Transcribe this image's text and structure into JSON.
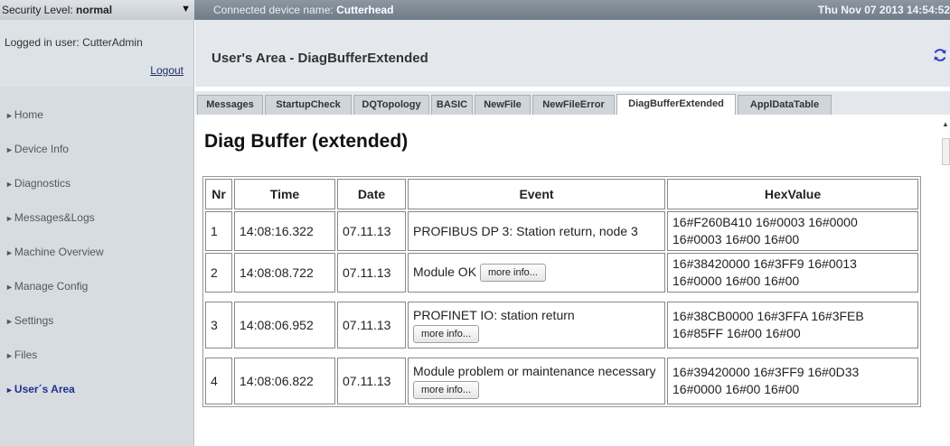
{
  "topbar": {
    "security_label": "Security Level:",
    "security_value": "normal",
    "connected_label": "Connected device name:",
    "device_name": "Cutterhead",
    "datetime": "Thu Nov 07 2013 14:54:52"
  },
  "login": {
    "user_text": "Logged in user: CutterAdmin",
    "logout": "Logout"
  },
  "sidebar": {
    "items": [
      {
        "label": "Home"
      },
      {
        "label": "Device Info"
      },
      {
        "label": "Diagnostics"
      },
      {
        "label": "Messages&Logs"
      },
      {
        "label": "Machine Overview"
      },
      {
        "label": "Manage Config"
      },
      {
        "label": "Settings"
      },
      {
        "label": "Files"
      },
      {
        "label": "User´s Area"
      }
    ],
    "active_index": 8
  },
  "header": {
    "title": "User's Area - DiagBufferExtended",
    "refresh_icon": "refresh-icon"
  },
  "tabs": [
    {
      "label": "Messages"
    },
    {
      "label": "StartupCheck"
    },
    {
      "label": "DQTopology"
    },
    {
      "label": "BASIC"
    },
    {
      "label": "NewFile"
    },
    {
      "label": "NewFileError"
    },
    {
      "label": "DiagBufferExtended"
    },
    {
      "label": "ApplDataTable"
    }
  ],
  "active_tab": 6,
  "page": {
    "heading": "Diag Buffer (extended)"
  },
  "table": {
    "headers": [
      "Nr",
      "Time",
      "Date",
      "Event",
      "HexValue"
    ],
    "rows": [
      {
        "nr": "1",
        "time": "14:08:16.322",
        "date": "07.11.13",
        "event": "PROFIBUS DP 3: Station return, node 3",
        "hex1": "16#F260B410 16#0003 16#0000",
        "hex2": "16#0003 16#00 16#00",
        "button": ""
      },
      {
        "nr": "2",
        "time": "14:08:08.722",
        "date": "07.11.13",
        "event": "Module OK",
        "hex1": "16#38420000 16#3FF9 16#0013",
        "hex2": "16#0000 16#00 16#00",
        "button": "more info..."
      },
      {
        "nr": "3",
        "time": "14:08:06.952",
        "date": "07.11.13",
        "event": "PROFINET IO: station return",
        "hex1": "16#38CB0000 16#3FFA 16#3FEB",
        "hex2": "16#85FF 16#00 16#00",
        "button": "more info..."
      },
      {
        "nr": "4",
        "time": "14:08:06.822",
        "date": "07.11.13",
        "event": "Module problem or maintenance necessary",
        "hex1": "16#39420000 16#3FF9 16#0D33",
        "hex2": "16#0000 16#00 16#00",
        "button": "more info..."
      }
    ]
  }
}
